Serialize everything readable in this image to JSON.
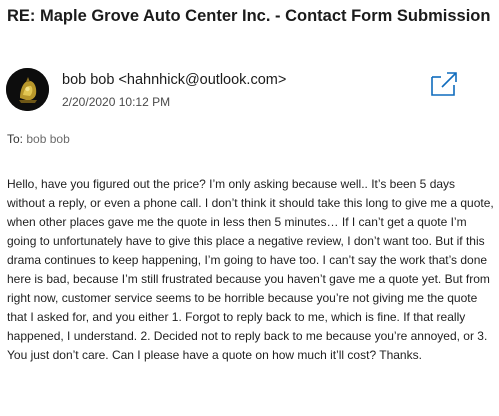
{
  "email": {
    "subject": "RE: Maple Grove Auto Center Inc. - Contact Form Submission",
    "sender_display": "bob bob <hahnhick@outlook.com>",
    "date": "2/20/2020 10:12 PM",
    "to_label": "To:",
    "to_value": "bob bob",
    "body": "Hello, have you figured out the price? I’m only asking because well.. It’s been 5 days without a reply, or even a phone call. I don’t think it should take this long to give me a quote, when other places gave me the quote in less then 5 minutes… If I can’t get a quote I’m going to unfortunately have to give this place a negative review, I don’t want too. But if this drama continues to keep happening, I’m going to have too. I can’t say the work that’s done here is bad, because I’m still frustrated because you haven’t gave me a quote yet. But from right now, customer service seems to be horrible because you’re not giving me the quote that I asked for, and you either 1. Forgot to reply back to me, which is fine. If that really happened, I understand. 2. Decided not to reply back to me because you’re annoyed, or 3. You just don’t care. Can I please have a quote on how much it’ll cost? Thanks."
  },
  "icons": {
    "avatar": "avatar-image",
    "popout": "open-in-new-window-icon"
  },
  "colors": {
    "accent": "#0f6cbd",
    "text": "#1f1f1f",
    "muted": "#6b6b6b"
  }
}
